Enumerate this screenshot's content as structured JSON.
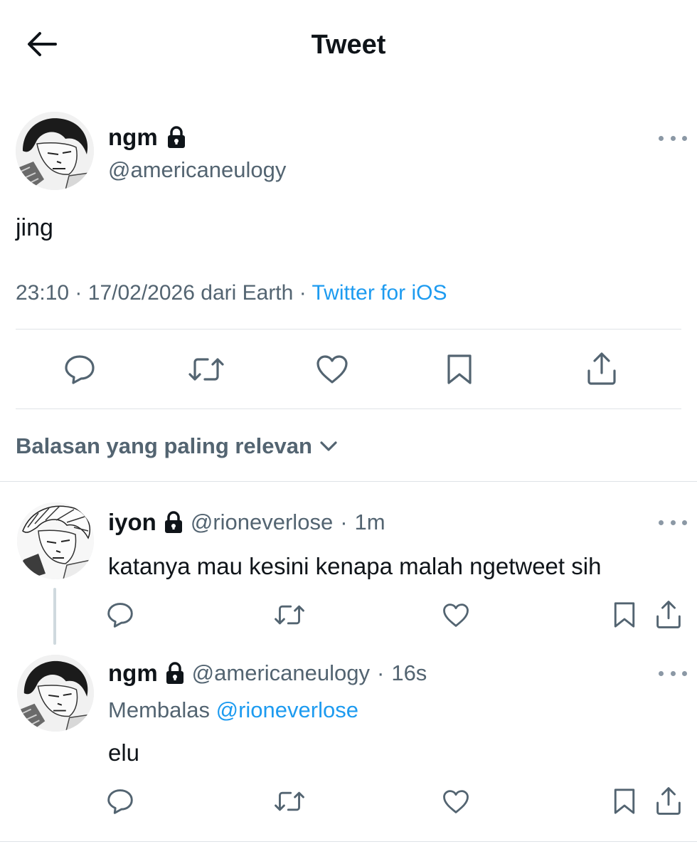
{
  "header": {
    "title": "Tweet"
  },
  "main_tweet": {
    "display_name": "ngm",
    "handle": "@americaneulogy",
    "text": "jing",
    "time": "23:10",
    "date": "17/02/2026",
    "location": "dari Earth",
    "separator": "·",
    "source": "Twitter for iOS"
  },
  "sort": {
    "label": "Balasan yang paling relevan"
  },
  "replies": [
    {
      "display_name": "iyon",
      "handle": "@rioneverlose",
      "separator": "·",
      "age": "1m",
      "text": "katanya mau kesini kenapa malah ngetweet sih"
    },
    {
      "display_name": "ngm",
      "handle": "@americaneulogy",
      "separator": "·",
      "age": "16s",
      "replying_prefix": "Membalas",
      "replying_to": "@rioneverlose",
      "text": "elu"
    }
  ],
  "icons": {
    "back": "arrow-left-icon",
    "lock": "lock-icon",
    "more": "more-horizontal-icon",
    "reply": "reply-icon",
    "retweet": "retweet-icon",
    "like": "heart-icon",
    "bookmark": "bookmark-icon",
    "share": "share-icon",
    "chevron": "chevron-down-icon"
  },
  "colors": {
    "text": "#0f1419",
    "secondary": "#536471",
    "link": "#1d9bf0",
    "divider": "#dfe3e7"
  }
}
